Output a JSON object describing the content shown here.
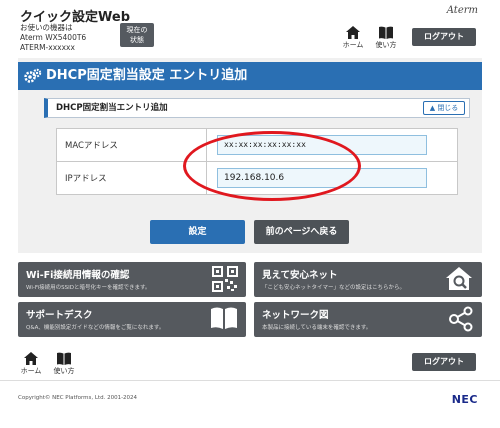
{
  "header": {
    "app_title": "クイック設定Web",
    "device_label": "お使いの機器は",
    "device_model": "Aterm WX5400T6",
    "device_id": "ATERM-xxxxxx",
    "status_button_line1": "現在の",
    "status_button_line2": "状態",
    "brand": "Aterm",
    "home_label": "ホーム",
    "help_label": "使い方",
    "logout_label": "ログアウト"
  },
  "panel": {
    "title": "DHCP固定割当設定 エントリ追加",
    "section_title": "DHCP固定割当エントリ追加",
    "close_label": "閉じる",
    "fields": [
      {
        "label": "MACアドレス",
        "value": "xx:xx:xx:xx:xx:xx"
      },
      {
        "label": "IPアドレス",
        "value": "192.168.10.6"
      }
    ],
    "submit_label": "設定",
    "back_label": "前のページへ戻る"
  },
  "tiles": [
    {
      "title": "Wi-Fi接続用情報の確認",
      "desc": "Wi-Fi接続用のSSIDと暗号化キーを確認できます。",
      "icon": "qr-code-icon"
    },
    {
      "title": "見えて安心ネット",
      "desc": "「こども安心ネットタイマー」などの設定はこちらから。",
      "icon": "home-search-icon"
    },
    {
      "title": "サポートデスク",
      "desc": "Q&A、機能別設定ガイドなどの情報をご覧になれます。",
      "icon": "book-icon"
    },
    {
      "title": "ネットワーク図",
      "desc": "本製品に接続している端末を確認できます。",
      "icon": "network-icon"
    }
  ],
  "footer": {
    "home_label": "ホーム",
    "help_label": "使い方",
    "logout_label": "ログアウト",
    "copyright": "Copyright© NEC Platforms, Ltd. 2001-2024",
    "nec_logo": "NEC"
  },
  "colors": {
    "accent_blue": "#2a6fb3",
    "dark_gray": "#4d5257",
    "highlight_red": "#e0181f"
  }
}
